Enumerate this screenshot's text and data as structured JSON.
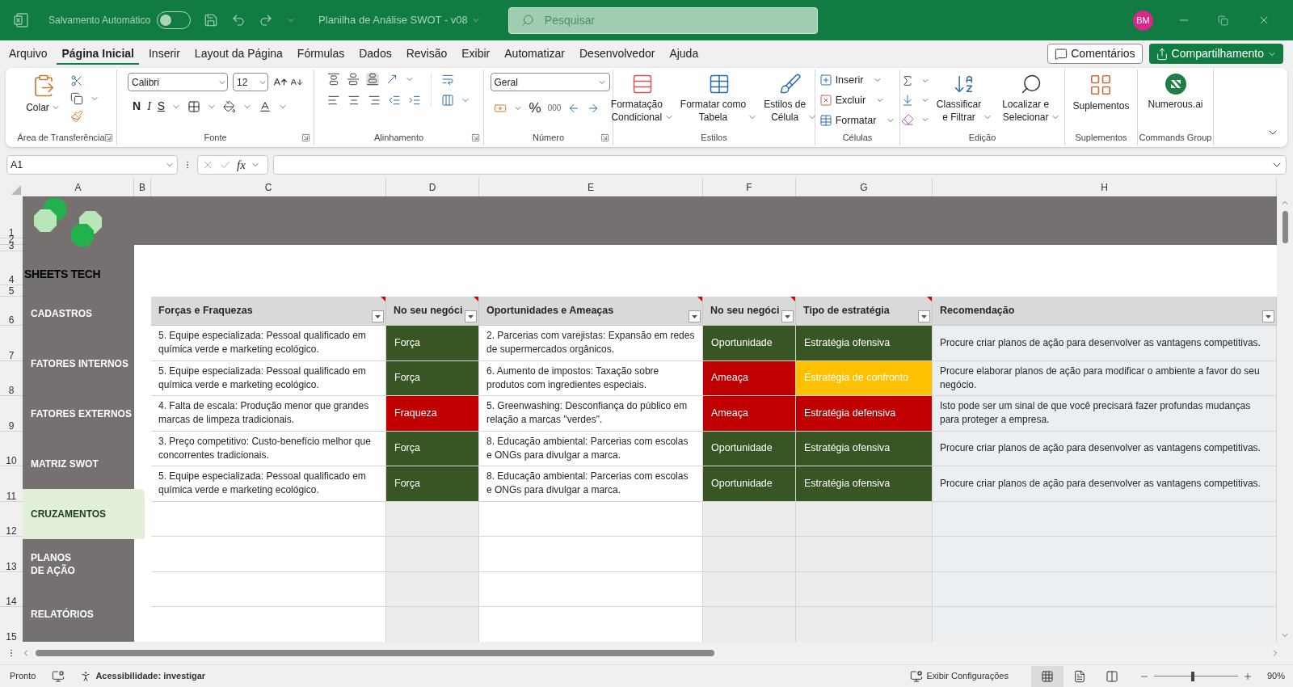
{
  "title_bar": {
    "autosave_label": "Salvamento Automático",
    "autosave_on": false,
    "document_title": "Planilha de Análise SWOT - v08",
    "search": {
      "placeholder": "Pesquisar"
    },
    "user_initials": "BM"
  },
  "menu_tabs": [
    {
      "label": "Arquivo",
      "selected": false
    },
    {
      "label": "Página Inicial",
      "selected": true
    },
    {
      "label": "Inserir",
      "selected": false
    },
    {
      "label": "Layout da Página",
      "selected": false
    },
    {
      "label": "Fórmulas",
      "selected": false
    },
    {
      "label": "Dados",
      "selected": false
    },
    {
      "label": "Revisão",
      "selected": false
    },
    {
      "label": "Exibir",
      "selected": false
    },
    {
      "label": "Automatizar",
      "selected": false
    },
    {
      "label": "Desenvolvedor",
      "selected": false
    },
    {
      "label": "Ajuda",
      "selected": false
    }
  ],
  "header_buttons": {
    "comments": "Comentários",
    "share": "Compartilhamento"
  },
  "ribbon": {
    "clipboard": {
      "paste": "Colar",
      "label": "Área de Transferência"
    },
    "font": {
      "family": "Calibri",
      "size": "12",
      "bold": "N",
      "italic": "I",
      "underline": "S",
      "label": "Fonte"
    },
    "alignment": {
      "label": "Alinhamento"
    },
    "number": {
      "format": "Geral",
      "percent": "%",
      "thousands": "000",
      "label": "Número"
    },
    "styles": {
      "buttons": [
        "Formatação\nCondicional",
        "Formatar como\nTabela",
        "Estilos de\nCélula"
      ],
      "label": "Estilos"
    },
    "cells": {
      "buttons": [
        "Inserir",
        "Excluir",
        "Formatar"
      ],
      "label": "Células"
    },
    "editing": {
      "buttons": [
        "Classificar\ne Filtrar",
        "Localizar e\nSelecionar"
      ],
      "label": "Edição"
    },
    "addins": {
      "button": "Suplementos",
      "label": "Suplementos"
    },
    "commands": {
      "button": "Numerous.ai",
      "label": "Commands Group"
    }
  },
  "formula_bar": {
    "name_box": "A1",
    "function_label": "fx"
  },
  "column_letters": [
    "A",
    "B",
    "C",
    "D",
    "E",
    "F",
    "G",
    "H"
  ],
  "row_numbers": [
    "1",
    "2",
    "3",
    "4",
    "5",
    "6",
    "7",
    "8",
    "9",
    "10",
    "11",
    "12",
    "13",
    "14",
    "15"
  ],
  "sidebar": {
    "brand": "SHEETS TECH",
    "items": [
      {
        "label": "CADASTROS",
        "selected": false
      },
      {
        "label": "FATORES INTERNOS",
        "selected": false
      },
      {
        "label": "FATORES EXTERNOS",
        "selected": false
      },
      {
        "label": "MATRIZ SWOT",
        "selected": false
      },
      {
        "label": "CRUZAMENTOS",
        "selected": true
      },
      {
        "label": "PLANOS\nDE AÇÃO",
        "selected": false
      },
      {
        "label": "RELATÓRIOS",
        "selected": false
      }
    ]
  },
  "table": {
    "columns": [
      {
        "label": "Forças e Fraquezas",
        "note": true
      },
      {
        "label": "No seu negóci",
        "note": true
      },
      {
        "label": "Oportunidades e Ameaças",
        "note": true
      },
      {
        "label": "No seu negóci",
        "note": true
      },
      {
        "label": "Tipo de estratégia",
        "note": true
      },
      {
        "label": "Recomendação",
        "note": false
      }
    ],
    "rows": [
      {
        "strength": "5. Equipe especializada: Pessoal qualificado em química verde e marketing ecológico.",
        "strength_type": {
          "text": "Força",
          "color": "#375623"
        },
        "opportunity": "2. Parcerias com varejistas: Expansão em redes de supermercados orgânicos.",
        "opportunity_type": {
          "text": "Oportunidade",
          "color": "#375623"
        },
        "strategy": {
          "text": "Estratégia ofensiva",
          "color": "#375623"
        },
        "recommendation": "Procure criar planos de ação para desenvolver as vantagens competitivas."
      },
      {
        "strength": "5. Equipe especializada: Pessoal qualificado em química verde e marketing ecológico.",
        "strength_type": {
          "text": "Força",
          "color": "#375623"
        },
        "opportunity": "6. Aumento de impostos: Taxação sobre produtos com ingredientes especiais.",
        "opportunity_type": {
          "text": "Ameaça",
          "color": "#c00000"
        },
        "strategy": {
          "text": "Estratégia de confronto",
          "color": "#ffc000"
        },
        "recommendation": "Procure elaborar planos de ação para modificar o ambiente a favor do seu negócio."
      },
      {
        "strength": "4. Falta de escala: Produção menor que grandes marcas de limpeza tradicionais.",
        "strength_type": {
          "text": "Fraqueza",
          "color": "#c00000"
        },
        "opportunity": "5. Greenwashing: Desconfiança do público em relação a marcas \"verdes\".",
        "opportunity_type": {
          "text": "Ameaça",
          "color": "#c00000"
        },
        "strategy": {
          "text": "Estratégia defensiva",
          "color": "#c00000"
        },
        "recommendation": "Isto pode ser um sinal de que você precisará fazer profundas mudanças para proteger a empresa."
      },
      {
        "strength": "3. Preço competitivo: Custo-benefício melhor que concorrentes tradicionais.",
        "strength_type": {
          "text": "Força",
          "color": "#375623"
        },
        "opportunity": "8. Educação ambiental: Parcerias com escolas e ONGs para divulgar a marca.",
        "opportunity_type": {
          "text": "Oportunidade",
          "color": "#375623"
        },
        "strategy": {
          "text": "Estratégia ofensiva",
          "color": "#375623"
        },
        "recommendation": "Procure criar planos de ação para desenvolver as vantagens competitivas."
      },
      {
        "strength": "5. Equipe especializada: Pessoal qualificado em química verde e marketing ecológico.",
        "strength_type": {
          "text": "Força",
          "color": "#375623"
        },
        "opportunity": "8. Educação ambiental: Parcerias com escolas e ONGs para divulgar a marca.",
        "opportunity_type": {
          "text": "Oportunidade",
          "color": "#375623"
        },
        "strategy": {
          "text": "Estratégia ofensiva",
          "color": "#375623"
        },
        "recommendation": "Procure criar planos de ação para desenvolver as vantagens competitivas."
      }
    ]
  },
  "status_bar": {
    "status": "Pronto",
    "accessibility": "Acessibilidade: investigar",
    "display_settings": "Exibir Configurações",
    "views": [
      {
        "kind": "normal",
        "selected": true
      },
      {
        "kind": "page_layout",
        "selected": false
      },
      {
        "kind": "page_break",
        "selected": false
      }
    ],
    "zoom": {
      "level": 0.46,
      "reading": "90%"
    }
  }
}
